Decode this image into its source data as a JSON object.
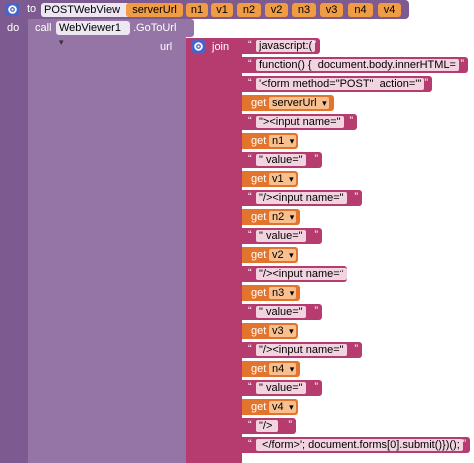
{
  "procedure": {
    "to_label": "to",
    "name": "POSTWebView",
    "params": [
      "serverUrl",
      "n1",
      "v1",
      "n2",
      "v2",
      "n3",
      "v3",
      "n4",
      "v4"
    ],
    "do_label": "do"
  },
  "call": {
    "call_label": "call",
    "component": "WebViewer1",
    "method": ".GoToUrl",
    "arg_label": "url"
  },
  "join": {
    "label": "join"
  },
  "items": [
    {
      "kind": "text",
      "value": "javascript:("
    },
    {
      "kind": "text",
      "value": "function() {  document.body.innerHTML="
    },
    {
      "kind": "text",
      "value": "'<form method=\"POST\"  action=\"'"
    },
    {
      "kind": "get",
      "get_label": "get",
      "var": "serverUrl"
    },
    {
      "kind": "text",
      "value": "\"><input name=\""
    },
    {
      "kind": "get",
      "get_label": "get",
      "var": "n1"
    },
    {
      "kind": "text",
      "value": "\" value=\""
    },
    {
      "kind": "get",
      "get_label": "get",
      "var": "v1"
    },
    {
      "kind": "text",
      "value": "\"/><input name=\""
    },
    {
      "kind": "get",
      "get_label": "get",
      "var": "n2"
    },
    {
      "kind": "text",
      "value": "\" value=\""
    },
    {
      "kind": "get",
      "get_label": "get",
      "var": "v2"
    },
    {
      "kind": "text",
      "value": "\"/><input name=\""
    },
    {
      "kind": "get",
      "get_label": "get",
      "var": "n3"
    },
    {
      "kind": "text",
      "value": "\" value=\""
    },
    {
      "kind": "get",
      "get_label": "get",
      "var": "v3"
    },
    {
      "kind": "text",
      "value": "\"/><input name=\""
    },
    {
      "kind": "get",
      "get_label": "get",
      "var": "n4"
    },
    {
      "kind": "text",
      "value": "\" value=\""
    },
    {
      "kind": "get",
      "get_label": "get",
      "var": "v4"
    },
    {
      "kind": "text",
      "value": "\"/> "
    },
    {
      "kind": "text",
      "value": " </form>'; document.forms[0].submit()})();"
    }
  ],
  "colors": {
    "procedure": "#7d5a8f",
    "call": "#9575a5",
    "text": "#b63b6e",
    "get": "#e3742d",
    "param": "#ef9c45"
  }
}
